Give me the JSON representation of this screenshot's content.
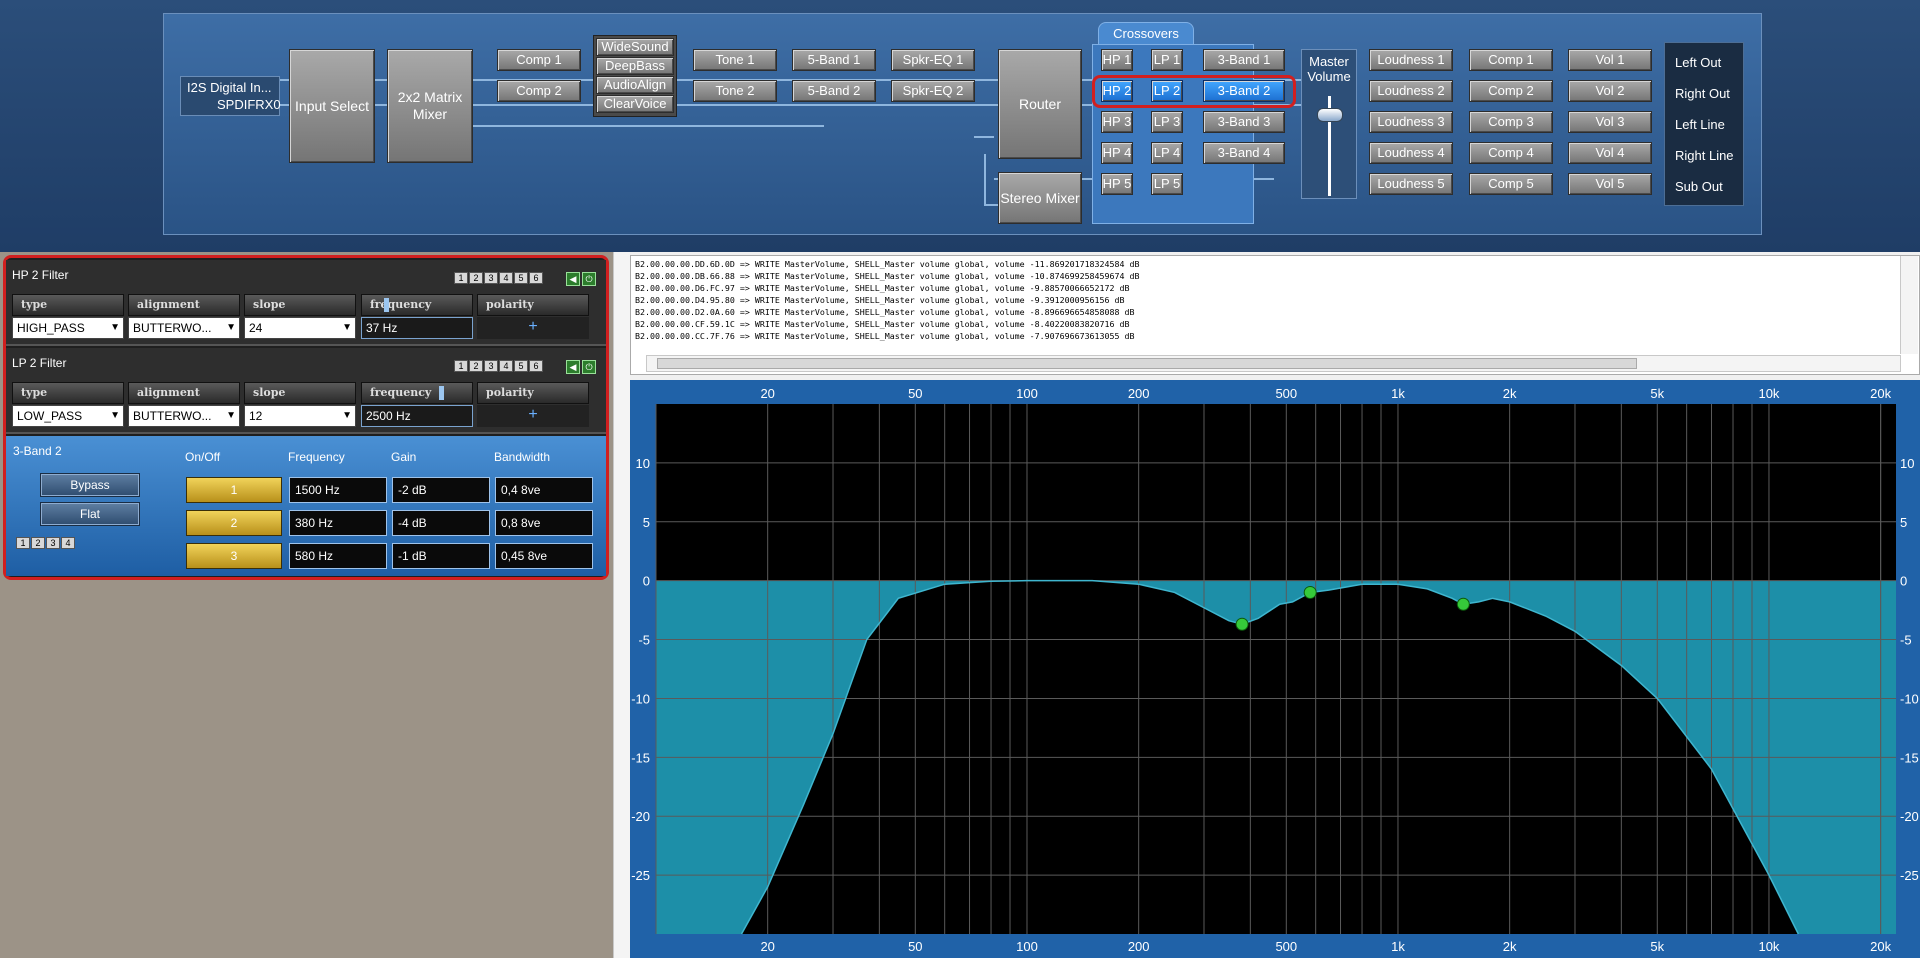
{
  "signal_flow": {
    "input_source": {
      "line1": "I2S Digital In...",
      "line2": "SPDIFRX0"
    },
    "input_select": "Input Select",
    "matrix_mixer": "2x2 Matrix Mixer",
    "comp_left": [
      "Comp 1",
      "Comp 2"
    ],
    "effects": [
      "WideSound",
      "DeepBass",
      "AudioAlign",
      "ClearVoice"
    ],
    "tone": [
      "Tone 1",
      "Tone 2"
    ],
    "five_band": [
      "5-Band 1",
      "5-Band 2"
    ],
    "spkr_eq": [
      "Spkr-EQ 1",
      "Spkr-EQ 2"
    ],
    "router": "Router",
    "stereo_mixer": "Stereo Mixer",
    "crossovers_tab": "Crossovers",
    "hp": [
      "HP 1",
      "HP 2",
      "HP 3",
      "HP 4",
      "HP 5"
    ],
    "lp": [
      "LP 1",
      "LP 2",
      "LP 3",
      "LP 4",
      "LP 5"
    ],
    "three_band": [
      "3-Band 1",
      "3-Band 2",
      "3-Band 3",
      "3-Band 4"
    ],
    "master_volume": "Master Volume",
    "loudness": [
      "Loudness 1",
      "Loudness 2",
      "Loudness 3",
      "Loudness 4",
      "Loudness 5"
    ],
    "comp_right": [
      "Comp 1",
      "Comp 2",
      "Comp 3",
      "Comp 4",
      "Comp 5"
    ],
    "vol": [
      "Vol 1",
      "Vol 2",
      "Vol 3",
      "Vol 4",
      "Vol 5"
    ],
    "outputs": [
      "Left Out",
      "Right Out",
      "Left Line",
      "Right Line",
      "Sub Out"
    ]
  },
  "hp_filter": {
    "title": "HP 2 Filter",
    "type_label": "type",
    "type_value": "HIGH_PASS",
    "alignment_label": "alignment",
    "alignment_value": "BUTTERWO...",
    "slope_label": "slope",
    "slope_value": "24",
    "frequency_label": "frequency",
    "frequency_value": "37 Hz",
    "polarity_label": "polarity",
    "polarity_value": "+"
  },
  "lp_filter": {
    "title": "LP 2 Filter",
    "type_label": "type",
    "type_value": "LOW_PASS",
    "alignment_label": "alignment",
    "alignment_value": "BUTTERWO...",
    "slope_label": "slope",
    "slope_value": "12",
    "frequency_label": "frequency",
    "frequency_value": "2500 Hz",
    "polarity_label": "polarity",
    "polarity_value": "+"
  },
  "channel_buttons": [
    "1",
    "2",
    "3",
    "4",
    "5",
    "6"
  ],
  "eq3": {
    "title": "3-Band 2",
    "headers": {
      "onoff": "On/Off",
      "frequency": "Frequency",
      "gain": "Gain",
      "bandwidth": "Bandwidth"
    },
    "bypass": "Bypass",
    "flat": "Flat",
    "mini_buttons": [
      "1",
      "2",
      "3",
      "4"
    ],
    "bands": [
      {
        "id": "1",
        "frequency": "1500 Hz",
        "gain": "-2 dB",
        "bandwidth": "0,4 8ve"
      },
      {
        "id": "2",
        "frequency": "380 Hz",
        "gain": "-4 dB",
        "bandwidth": "0,8 8ve"
      },
      {
        "id": "3",
        "frequency": "580 Hz",
        "gain": "-1 dB",
        "bandwidth": "0,45 8ve"
      }
    ]
  },
  "log_lines": [
    "B2.00.00.00.DD.6D.0D => WRITE MasterVolume, SHELL_Master volume global, volume -11.869201718324584 dB",
    "B2.00.00.00.DB.66.88 => WRITE MasterVolume, SHELL_Master volume global, volume -10.874699258459674 dB",
    "B2.00.00.00.D6.FC.97 => WRITE MasterVolume, SHELL_Master volume global, volume -9.88570066652172 dB",
    "B2.00.00.00.D4.95.80 => WRITE MasterVolume, SHELL_Master volume global, volume -9.3912000956156 dB",
    "B2.00.00.00.D2.0A.60 => WRITE MasterVolume, SHELL_Master volume global, volume -8.896696654858088 dB",
    "B2.00.00.00.CF.59.1C => WRITE MasterVolume, SHELL_Master volume global, volume -8.40220083820716 dB",
    "B2.00.00.00.CC.7F.76 => WRITE MasterVolume, SHELL_Master volume global, volume -7.907696673613055 dB"
  ],
  "chart_data": {
    "type": "line",
    "x_scale": "log",
    "xlim": [
      10,
      22000
    ],
    "ylim": [
      -30,
      15
    ],
    "x_ticks": [
      "20",
      "50",
      "100",
      "200",
      "500",
      "1k",
      "2k",
      "5k",
      "10k",
      "20k"
    ],
    "x_tick_values": [
      20,
      50,
      100,
      200,
      500,
      1000,
      2000,
      5000,
      10000,
      20000
    ],
    "y_ticks": [
      10,
      5,
      0,
      -5,
      -10,
      -15,
      -20,
      -25
    ],
    "y_tick_labels": [
      "10",
      "5",
      "0",
      "-5",
      "-10",
      "-15",
      "-20",
      "-25"
    ],
    "grid": true,
    "fill_color": "#1d8fa8",
    "curve": {
      "x": [
        17,
        20,
        25,
        30,
        37,
        45,
        60,
        80,
        100,
        150,
        200,
        250,
        300,
        350,
        380,
        420,
        480,
        520,
        580,
        650,
        800,
        1000,
        1200,
        1400,
        1500,
        1650,
        1800,
        2000,
        2500,
        3000,
        4000,
        5000,
        7000,
        10000,
        12000
      ],
      "y": [
        -30,
        -26,
        -19,
        -13,
        -5,
        -1.5,
        -0.3,
        -0.05,
        0,
        0,
        -0.3,
        -1,
        -2.3,
        -3.4,
        -3.7,
        -3.2,
        -2.0,
        -1.8,
        -1.0,
        -0.8,
        -0.3,
        -0.3,
        -0.7,
        -1.5,
        -2.0,
        -1.8,
        -1.5,
        -1.8,
        -3,
        -4.3,
        -7.2,
        -10,
        -16,
        -25,
        -30
      ]
    },
    "markers": [
      {
        "x": 380,
        "y": -3.7
      },
      {
        "x": 580,
        "y": -1.0
      },
      {
        "x": 1500,
        "y": -2.0
      }
    ],
    "marker_color": "#36c93a"
  }
}
